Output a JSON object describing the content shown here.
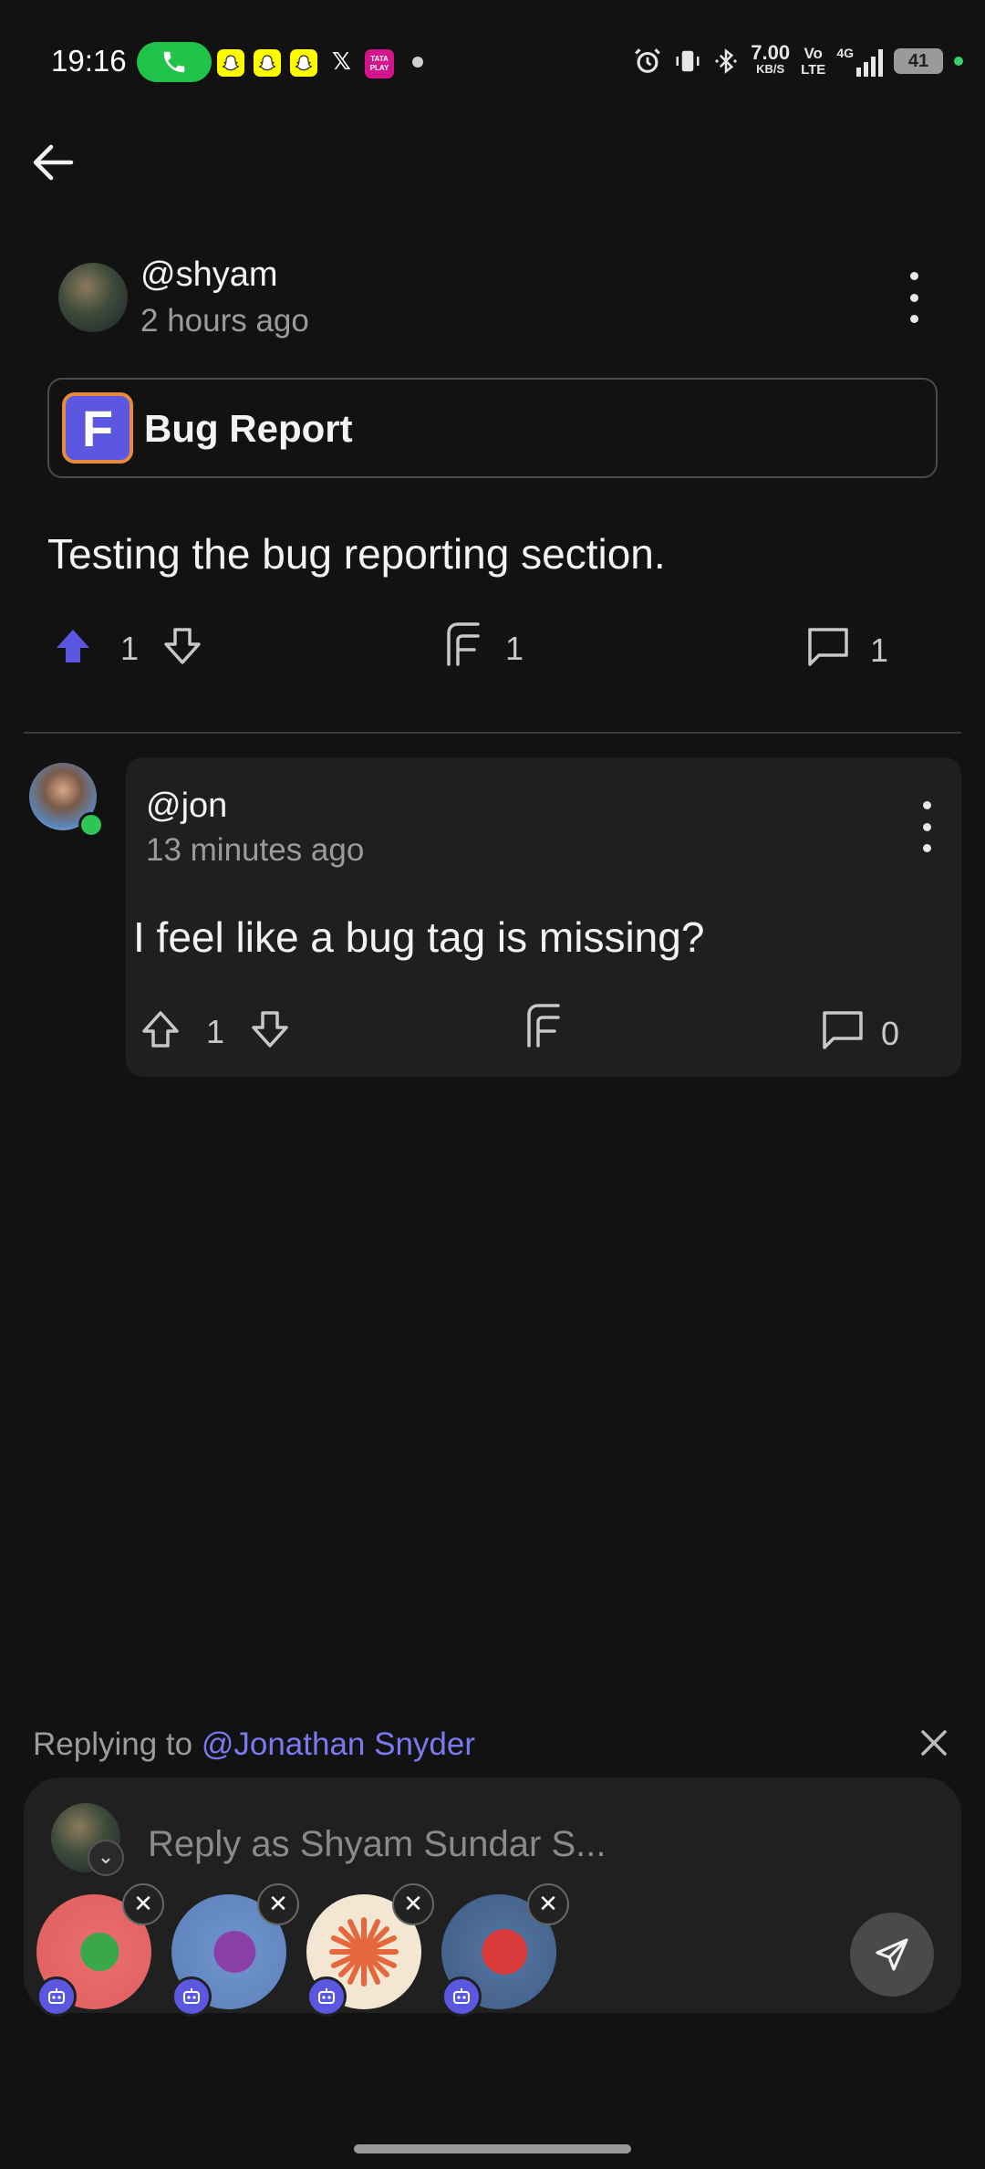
{
  "status_bar": {
    "time": "19:16",
    "speed_value": "7.00",
    "speed_unit": "KB/S",
    "volte_top": "Vo",
    "volte_bottom": "LTE",
    "network": "4G",
    "battery": "41",
    "tata_label": "TATA PLAY",
    "x_label": "𝕏"
  },
  "post": {
    "username": "@shyam",
    "timestamp": "2 hours ago",
    "tag_logo_letter": "F",
    "tag_label": "Bug Report",
    "body": "Testing the bug reporting section.",
    "upvotes": "1",
    "shares": "1",
    "comments": "1"
  },
  "comment": {
    "username": "@jon",
    "timestamp": "13 minutes ago",
    "body": "I feel like a bug tag is missing?",
    "upvotes": "1",
    "comments": "0"
  },
  "reply": {
    "prefix": "Replying to ",
    "target": "@Jonathan Snyder",
    "placeholder": "Reply as Shyam Sundar S...",
    "bots": [
      "green-robot",
      "purple-robot",
      "orange-starburst",
      "red-robot"
    ]
  },
  "colors": {
    "accent": "#5b57e0",
    "background": "#121212",
    "card": "#1f1f1f",
    "online": "#2fc455"
  }
}
